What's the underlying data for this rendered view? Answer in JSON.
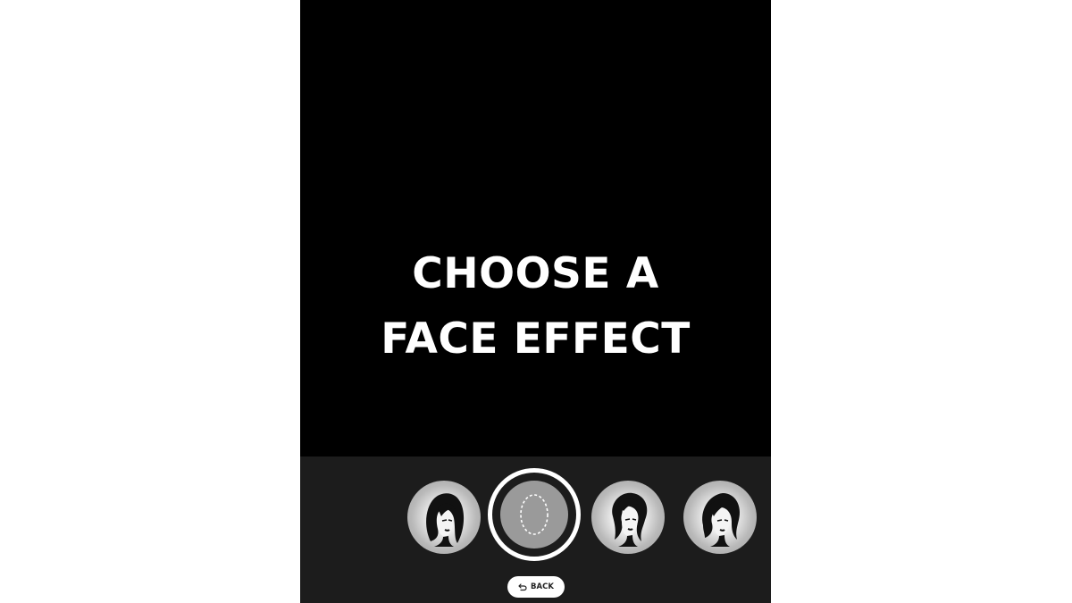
{
  "headline": {
    "line1": "CHOOSE A",
    "line2": "FACE EFFECT"
  },
  "effects": [
    {
      "icon": "woman-face-long-hair-icon"
    },
    {
      "icon": "no-effect-face-outline-icon",
      "selected": true
    },
    {
      "icon": "woman-face-wavy-hair-icon"
    },
    {
      "icon": "woman-face-swept-hair-icon"
    }
  ],
  "back_button": {
    "label": "BACK",
    "icon": "return-arrow-icon"
  },
  "colors": {
    "background": "#000000",
    "tray": "#1c1c1c",
    "selected_ring": "#ffffff",
    "effect_bg": "#9a9a9a"
  }
}
